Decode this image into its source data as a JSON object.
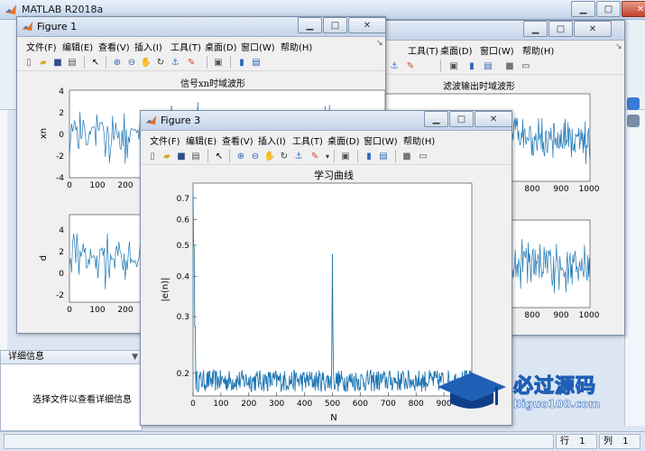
{
  "main_window": {
    "title": "MATLAB R2018a"
  },
  "details_panel": {
    "header": "详细信息",
    "empty_text": "选择文件以查看详细信息"
  },
  "statusbar": {
    "row_label": "行",
    "row_value": "1",
    "col_label": "列",
    "col_value": "1"
  },
  "figure_menu": [
    "文件(F)",
    "编辑(E)",
    "查看(V)",
    "插入(I)",
    "工具(T)",
    "桌面(D)",
    "窗口(W)",
    "帮助(H)"
  ],
  "figure1": {
    "title": "Figure 1",
    "top_axes": {
      "title": "信号xn时域波形",
      "ylabel": "xn",
      "yticks": [
        "4",
        "2",
        "0",
        "-2",
        "-4"
      ],
      "xticks": [
        "0",
        "100",
        "200"
      ]
    },
    "bottom_axes": {
      "ylabel": "d",
      "yticks": [
        "4",
        "2",
        "0",
        "-2"
      ],
      "xticks": [
        "0",
        "100",
        "200"
      ]
    }
  },
  "figure2": {
    "top_axes": {
      "title": "滤波输出时域波形",
      "xticks": [
        "800",
        "900",
        "1000"
      ]
    },
    "bottom_axes": {
      "xticks": [
        "800",
        "900",
        "1000"
      ]
    }
  },
  "figure3": {
    "title": "Figure 3",
    "chart_data": {
      "type": "line",
      "title": "学习曲线",
      "xlabel": "N",
      "ylabel": "|e(n)|",
      "xlim": [
        0,
        1000
      ],
      "ylim": [
        0.17,
        0.78
      ],
      "yscale": "log",
      "xticks": [
        "0",
        "100",
        "200",
        "300",
        "400",
        "500",
        "600",
        "700",
        "800",
        "900",
        "1000"
      ],
      "yticks": [
        "0.2",
        "0.3",
        "0.4",
        "0.5",
        "0.6",
        "0.7"
      ],
      "color": "#1f77b4",
      "key_points": [
        {
          "x": 0,
          "y": 0.72
        },
        {
          "x": 3,
          "y": 0.55
        },
        {
          "x": 6,
          "y": 0.3
        },
        {
          "x": 10,
          "y": 0.21
        },
        {
          "x": 100,
          "y": 0.19
        },
        {
          "x": 495,
          "y": 0.19
        },
        {
          "x": 500,
          "y": 0.47
        },
        {
          "x": 505,
          "y": 0.2
        },
        {
          "x": 1000,
          "y": 0.19
        }
      ],
      "noise_band": [
        0.175,
        0.205
      ]
    }
  },
  "watermark": {
    "text": "必过源码",
    "sub": "Biguo100.com"
  },
  "colors": {
    "signal": "#1f77b4",
    "titlebar": "#c4d4ea"
  }
}
